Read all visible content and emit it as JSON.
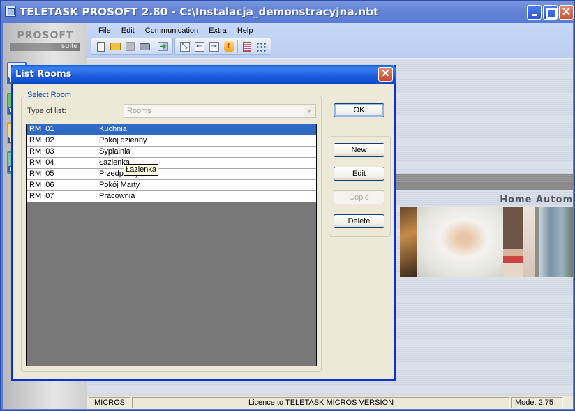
{
  "window": {
    "title": "TELETASK PROSOFT 2.80 - C:\\Instalacja_demonstracyjna.nbt",
    "controls": {
      "minimize": "minimize",
      "maximize": "maximize",
      "close": "✕"
    }
  },
  "brand": {
    "top": "PROSOFT",
    "bottom": "suite"
  },
  "sidebar": {
    "buttons": [
      {
        "label": "TE",
        "color": "#3568c9"
      },
      {
        "label": "TE",
        "color": "#3fa040"
      },
      {
        "label": "TE",
        "color": "#d2a030"
      },
      {
        "label": "TE",
        "color": "#3a9a8a"
      }
    ]
  },
  "menu": {
    "items": [
      "File",
      "Edit",
      "Communication",
      "Extra",
      "Help"
    ]
  },
  "toolbar": {
    "groups": [
      [
        "new-icon",
        "open-icon",
        "save-icon",
        "print-icon",
        "transfer-icon"
      ],
      [
        "fit-icon",
        "import-icon",
        "export-icon",
        "function-icon",
        "list-edit-icon",
        "tree-icon"
      ]
    ],
    "glyphs": {
      "transfer": "➜",
      "fit": "⤡",
      "import": "⇤",
      "export": "⇥",
      "function": "f"
    }
  },
  "banner": {
    "title": "Home Autom"
  },
  "statusbar": {
    "left": "MICROS",
    "center": "Licence to TELETASK MICROS VERSION",
    "right": "Mode: 2.75"
  },
  "dialog": {
    "title": "List Rooms",
    "close": "✕",
    "group_label": "Select Room",
    "type_label": "Type of list:",
    "type_value": "Rooms",
    "select_arrow": "▼",
    "rooms": [
      {
        "code": "RM  01",
        "name": "Kuchnia",
        "selected": true
      },
      {
        "code": "RM  02",
        "name": "Pokój dzienny",
        "selected": false
      },
      {
        "code": "RM  03",
        "name": "Sypialnia",
        "selected": false
      },
      {
        "code": "RM  04",
        "name": "Łazienka",
        "selected": false
      },
      {
        "code": "RM  05",
        "name": "Przedpokój",
        "selected": false
      },
      {
        "code": "RM  06",
        "name": "Pokój Marty",
        "selected": false
      },
      {
        "code": "RM  07",
        "name": "Pracownia",
        "selected": false
      }
    ],
    "tooltip": "Łazienka",
    "buttons": {
      "ok": "OK",
      "new": "New",
      "edit": "Edit",
      "copie": "Copie",
      "delete": "Delete"
    }
  }
}
